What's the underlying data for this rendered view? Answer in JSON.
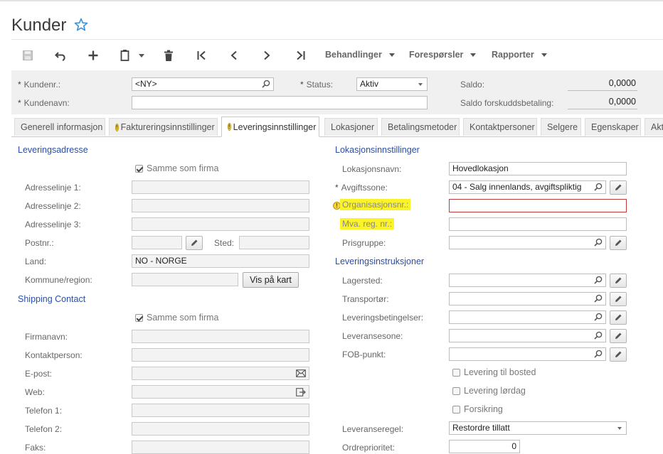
{
  "page": {
    "title": "Kunder"
  },
  "toolbar": {
    "menus": [
      {
        "label": "Behandlinger"
      },
      {
        "label": "Forespørsler"
      },
      {
        "label": "Rapporter"
      }
    ]
  },
  "header": {
    "kundenr_label": "Kundenr.:",
    "kundenr_value": "<NY>",
    "kundenavn_label": "Kundenavn:",
    "kundenavn_value": "",
    "status_label": "Status:",
    "status_value": "Aktiv",
    "saldo_label": "Saldo:",
    "saldo_value": "0,0000",
    "saldo_forskudd_label": "Saldo forskuddsbetaling:",
    "saldo_forskudd_value": "0,0000",
    "required_mark": "*"
  },
  "tabs": [
    {
      "label": "Generell informasjon",
      "warning": false
    },
    {
      "label": "Faktureringsinnstillinger",
      "warning": true
    },
    {
      "label": "Leveringsinnstillinger",
      "warning": true,
      "active": true
    },
    {
      "label": "Lokasjoner",
      "warning": false
    },
    {
      "label": "Betalingsmetoder",
      "warning": false
    },
    {
      "label": "Kontaktpersoner",
      "warning": false
    },
    {
      "label": "Selgere",
      "warning": false
    },
    {
      "label": "Egenskaper",
      "warning": false
    },
    {
      "label": "Akti",
      "warning": false
    }
  ],
  "left": {
    "delivery_title": "Leveringsadresse",
    "same_as_company": "Samme som firma",
    "adresse1": "Adresselinje 1:",
    "adresse2": "Adresselinje 2:",
    "adresse3": "Adresselinje 3:",
    "postnr": "Postnr.:",
    "sted": "Sted:",
    "land": "Land:",
    "land_value": "NO - NORGE",
    "kommune": "Kommune/region:",
    "vis_paa_kart": "Vis på kart",
    "shipping_title": "Shipping Contact",
    "same_as_company2": "Samme som firma",
    "firmanavn": "Firmanavn:",
    "kontaktperson": "Kontaktperson:",
    "epost": "E-post:",
    "web": "Web:",
    "telefon1": "Telefon 1:",
    "telefon2": "Telefon 2:",
    "faks": "Faks:"
  },
  "right": {
    "location_title": "Lokasjonsinnstillinger",
    "lokasjonsnavn": "Lokasjonsnavn:",
    "lokasjonsnavn_value": "Hovedlokasjon",
    "avgiftssone": "Avgiftssone:",
    "avgiftssone_value": "04 - Salg innenlands, avgiftspliktig",
    "orgnr": "Organisasjonsnr.:",
    "mva": "Mva. reg. nr.:",
    "prisgruppe": "Prisgruppe:",
    "instructions_title": "Leveringsinstruksjoner",
    "lagersted": "Lagersted:",
    "transportor": "Transportør:",
    "leveringsbetingelser": "Leveringsbetingelser:",
    "leveransesone": "Leveransesone:",
    "fob": "FOB-punkt:",
    "levering_bosted": "Levering til bosted",
    "levering_lordag": "Levering lørdag",
    "forsikring": "Forsikring",
    "leveranseregel": "Leveranseregel:",
    "leveranseregel_value": "Restordre tillatt",
    "ordreprioritet": "Ordreprioritet:",
    "ordreprioritet_value": "0"
  },
  "colors": {
    "section": "#2b4ea2",
    "highlight": "#faf32a",
    "error_border": "#c0393b"
  }
}
